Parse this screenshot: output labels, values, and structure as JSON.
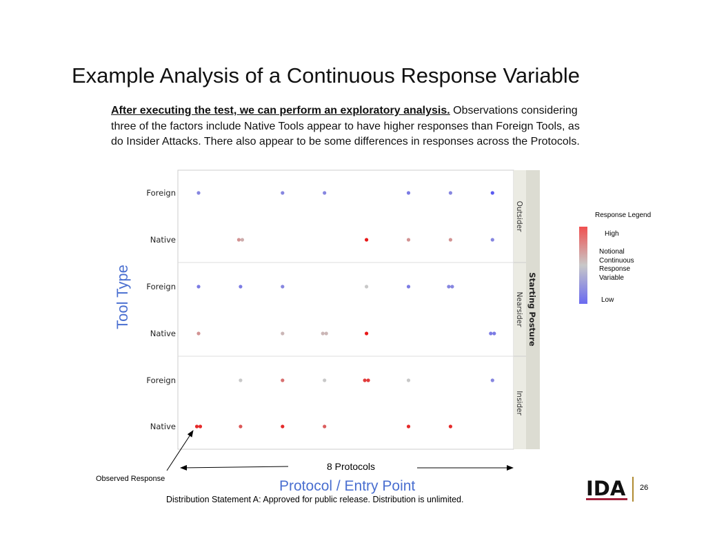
{
  "title": "Example Analysis of a Continuous Response Variable",
  "intro": {
    "lead": "After executing the test, we can perform an exploratory analysis.",
    "text": " Observations considering three of the factors include Native Tools appear to have higher responses than Foreign Tools, as do Insider Attacks. There also appear to be some differences in responses across the Protocols."
  },
  "annotations": {
    "protocols": "8 Protocols",
    "observed": "Observed Response"
  },
  "footer": {
    "distribution": "Distribution Statement A:  Approved for public release.  Distribution is unlimited.",
    "page": "26",
    "logo": "IDA"
  },
  "legend": {
    "title": "Response Legend",
    "high": "High",
    "middle": [
      "Notional",
      "Continuous",
      "Response",
      "Variable"
    ],
    "low": "Low",
    "colors": {
      "low": "#5a5af0",
      "mid": "#c8c8c8",
      "high": "#e81818"
    }
  },
  "chart_data": {
    "type": "scatter",
    "xlabel": "Protocol / Entry Point",
    "ylabel": "Tool Type",
    "group_label": "Starting Posture",
    "groups": [
      "Outsider",
      "Nearsider",
      "Insider"
    ],
    "tool_types": [
      "Foreign",
      "Native"
    ],
    "protocol_count": 8,
    "value_scale": "notional 0 (Low) to 1 (High), shown by color",
    "points": [
      {
        "group": "Outsider",
        "tool": "Foreign",
        "values": [
          [
            1,
            0.2
          ],
          [
            3,
            0.2
          ],
          [
            4,
            0.2
          ],
          [
            6,
            0.15
          ],
          [
            7,
            0.2
          ],
          [
            8,
            0.0
          ]
        ]
      },
      {
        "group": "Outsider",
        "tool": "Native",
        "values": [
          [
            2,
            0.65
          ],
          [
            2,
            0.58
          ],
          [
            5,
            1.0
          ],
          [
            6,
            0.65
          ],
          [
            7,
            0.65
          ],
          [
            8,
            0.2
          ]
        ]
      },
      {
        "group": "Nearsider",
        "tool": "Foreign",
        "values": [
          [
            1,
            0.15
          ],
          [
            2,
            0.15
          ],
          [
            3,
            0.2
          ],
          [
            5,
            0.5
          ],
          [
            6,
            0.15
          ],
          [
            7,
            0.2
          ],
          [
            7,
            0.2
          ]
        ]
      },
      {
        "group": "Nearsider",
        "tool": "Native",
        "values": [
          [
            1,
            0.65
          ],
          [
            3,
            0.55
          ],
          [
            4,
            0.55
          ],
          [
            4,
            0.55
          ],
          [
            5,
            1.0
          ],
          [
            8,
            0.15
          ],
          [
            8,
            0.15
          ]
        ]
      },
      {
        "group": "Insider",
        "tool": "Foreign",
        "values": [
          [
            2,
            0.5
          ],
          [
            3,
            0.75
          ],
          [
            4,
            0.5
          ],
          [
            5,
            0.9
          ],
          [
            5,
            0.9
          ],
          [
            6,
            0.5
          ],
          [
            8,
            0.2
          ]
        ]
      },
      {
        "group": "Insider",
        "tool": "Native",
        "values": [
          [
            1,
            0.95
          ],
          [
            1,
            0.95
          ],
          [
            2,
            0.82
          ],
          [
            3,
            0.95
          ],
          [
            4,
            0.8
          ],
          [
            6,
            0.95
          ],
          [
            7,
            0.95
          ]
        ]
      }
    ]
  }
}
